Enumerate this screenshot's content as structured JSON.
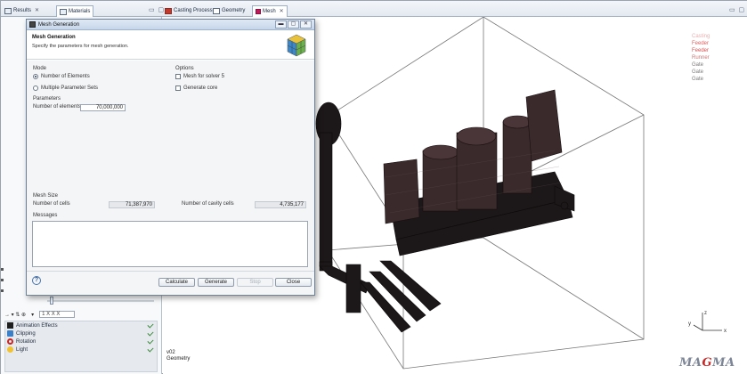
{
  "tabs_left": [
    {
      "label": "Results"
    },
    {
      "label": "Materials"
    }
  ],
  "tabs_right": [
    {
      "label": "Casting Process"
    },
    {
      "label": "Geometry"
    },
    {
      "label": "Mesh"
    }
  ],
  "dialog": {
    "window_title": "Mesh Generation",
    "header_title": "Mesh Generation",
    "header_subtitle": "Specify the parameters for mesh generation.",
    "mode_label": "Mode",
    "mode_options": [
      "Number of Elements",
      "Multiple Parameter Sets"
    ],
    "mode_selected": "Number of Elements",
    "options_label": "Options",
    "option_mesh_solver": "Mesh for solver 5",
    "option_generate_core": "Generate core",
    "parameters_label": "Parameters",
    "num_elements_label": "Number of elements",
    "num_elements_value": "70,000,000",
    "mesh_size_label": "Mesh Size",
    "num_cells_label": "Number of cells",
    "num_cells_value": "71,387,970",
    "num_cavity_label": "Number of cavity cells",
    "num_cavity_value": "4,735,177",
    "messages_label": "Messages",
    "buttons": {
      "calculate": "Calculate",
      "generate": "Generate",
      "stop": "Stop",
      "close": "Close"
    }
  },
  "left_panel": {
    "toolbar_text": "1 X X X",
    "effects": [
      {
        "label": "Animation Effects",
        "icon": "film-icon"
      },
      {
        "label": "Clipping",
        "icon": "clipping-icon"
      },
      {
        "label": "Rotation",
        "icon": "rotation-icon"
      },
      {
        "label": "Light",
        "icon": "light-icon"
      }
    ]
  },
  "viewport": {
    "legend": [
      {
        "label": "Casting",
        "color": "#e8b0b0"
      },
      {
        "label": "Feeder",
        "color": "#e06060"
      },
      {
        "label": "Feeder",
        "color": "#d85050"
      },
      {
        "label": "Runner",
        "color": "#c87878"
      },
      {
        "label": "Gate",
        "color": "#7a7a7a"
      },
      {
        "label": "Gate",
        "color": "#7a7a7a"
      },
      {
        "label": "Gate",
        "color": "#7a7a7a"
      }
    ],
    "info_line1": "v02",
    "info_line2": "Geometry",
    "logo_text": "MAGMA"
  }
}
